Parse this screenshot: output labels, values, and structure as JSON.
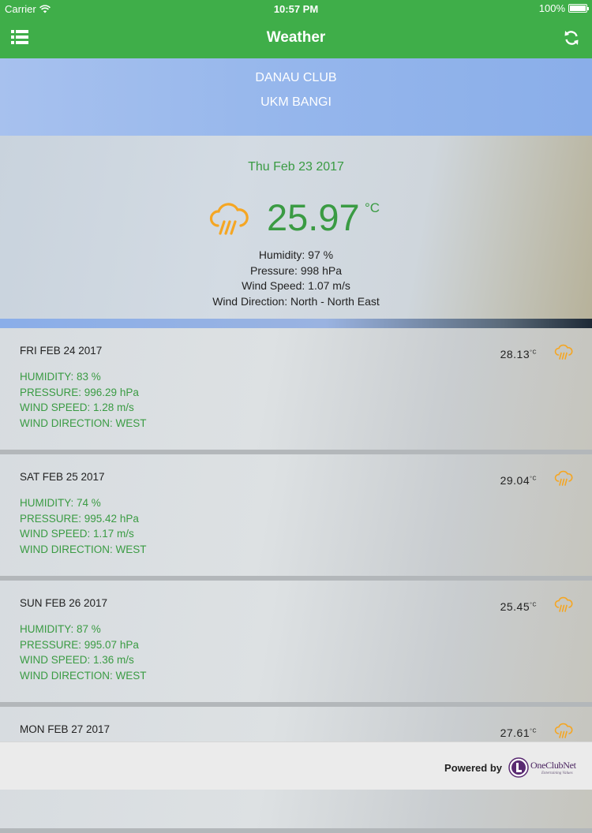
{
  "status_bar": {
    "carrier": "Carrier",
    "time": "10:57 PM",
    "battery": "100%"
  },
  "nav": {
    "title": "Weather",
    "menu_icon": "list-icon",
    "refresh_icon": "refresh-icon"
  },
  "location": {
    "line1": "DANAU CLUB",
    "line2": "UKM BANGI"
  },
  "current": {
    "date": "Thu Feb 23 2017",
    "temperature": "25.97",
    "unit": "°C",
    "icon": "rain-cloud-icon",
    "humidity": "Humidity: 97 %",
    "pressure": "Pressure: 998 hPa",
    "wind_speed": "Wind Speed: 1.07 m/s",
    "wind_direction": "Wind Direction: North - North East"
  },
  "forecast": [
    {
      "day": "FRI FEB 24 2017",
      "temp": "28.13",
      "unit": "°C",
      "icon": "rain-cloud-icon",
      "humidity": "HUMIDITY: 83 %",
      "pressure": "PRESSURE: 996.29 hPa",
      "wind_speed": "WIND SPEED: 1.28 m/s",
      "wind_direction": "WIND DIRECTION: WEST"
    },
    {
      "day": "SAT FEB 25 2017",
      "temp": "29.04",
      "unit": "°C",
      "icon": "rain-cloud-icon",
      "humidity": "HUMIDITY: 74 %",
      "pressure": "PRESSURE: 995.42 hPa",
      "wind_speed": "WIND SPEED: 1.17 m/s",
      "wind_direction": "WIND DIRECTION: WEST"
    },
    {
      "day": "SUN FEB 26 2017",
      "temp": "25.45",
      "unit": "°C",
      "icon": "rain-cloud-icon",
      "humidity": "HUMIDITY: 87 %",
      "pressure": "PRESSURE: 995.07 hPa",
      "wind_speed": "WIND SPEED: 1.36 m/s",
      "wind_direction": "WIND DIRECTION: WEST"
    },
    {
      "day": "MON FEB 27 2017",
      "temp": "27.61",
      "unit": "°C",
      "icon": "rain-cloud-icon"
    }
  ],
  "footer": {
    "powered_by": "Powered by",
    "brand": "OneClubNet",
    "tagline": "Entertaining Values"
  },
  "colors": {
    "accent": "#3fae49",
    "text_green": "#3a9b43",
    "icon_orange": "#f5a623",
    "location_blue": "#95b6ec"
  }
}
